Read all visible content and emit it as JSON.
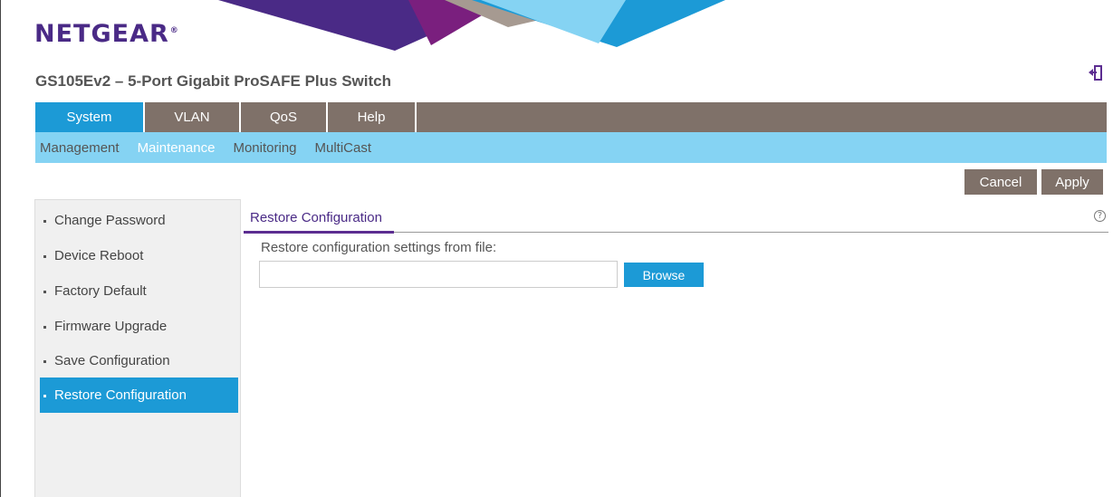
{
  "brand": {
    "logo_text": "NETGEAR",
    "logo_mark": "®",
    "product_title": "GS105Ev2 – 5-Port Gigabit ProSAFE Plus Switch",
    "colors": {
      "primary_blue": "#1c9ad6",
      "light_blue": "#85d3f3",
      "taupe": "#7f7169",
      "purple": "#4a2a86"
    }
  },
  "header": {
    "logout_icon": "logout-door-icon"
  },
  "top_nav": {
    "tabs": [
      {
        "label": "System",
        "active": true
      },
      {
        "label": "VLAN",
        "active": false
      },
      {
        "label": "QoS",
        "active": false
      },
      {
        "label": "Help",
        "active": false
      }
    ]
  },
  "sub_nav": {
    "items": [
      {
        "label": "Management",
        "active": false
      },
      {
        "label": "Maintenance",
        "active": true
      },
      {
        "label": "Monitoring",
        "active": false
      },
      {
        "label": "MultiCast",
        "active": false
      }
    ]
  },
  "actions": {
    "cancel_label": "Cancel",
    "apply_label": "Apply"
  },
  "sidebar": {
    "items": [
      {
        "label": "Change Password",
        "active": false
      },
      {
        "label": "Device Reboot",
        "active": false
      },
      {
        "label": "Factory Default",
        "active": false
      },
      {
        "label": "Firmware Upgrade",
        "active": false
      },
      {
        "label": "Save Configuration",
        "active": false
      },
      {
        "label": "Restore Configuration",
        "active": true
      }
    ]
  },
  "main": {
    "section_title": "Restore Configuration",
    "help_icon": "question-circle-icon",
    "field_label": "Restore configuration settings from file:",
    "file_value": "",
    "file_placeholder": "",
    "browse_label": "Browse"
  }
}
